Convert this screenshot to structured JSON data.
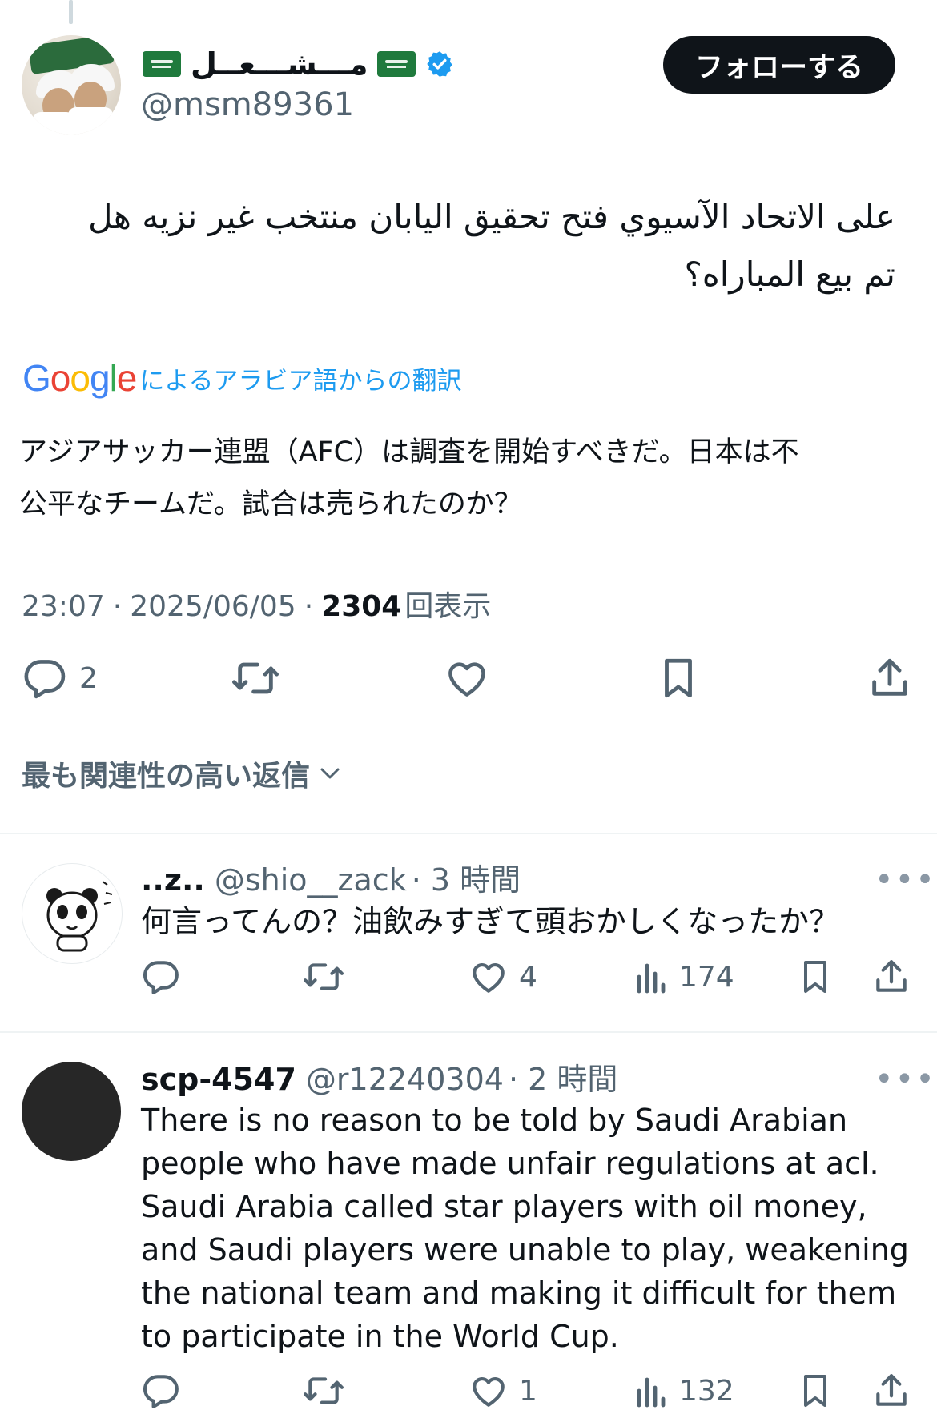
{
  "tweet": {
    "display_name": "مـــشـــعــل",
    "handle": "@msm89361",
    "follow_label": "フォローする",
    "text_original_line1": "على الاتحاد الآسيوي فتح تحقيق اليابان منتخب غير نزيه هل",
    "text_original_line2": "تم بيع المباراه؟",
    "translation_prefix": "Google",
    "translation_label": "によるアラビア語からの翻訳",
    "text_translated_line1": "アジアサッカー連盟（AFC）は調査を開始すべきだ。日本は不",
    "text_translated_line2": "公平なチームだ。試合は売られたのか？",
    "time": "23:07",
    "date": "2025/06/05",
    "views_count": "2304",
    "views_label": "回表示",
    "sep": "·",
    "reply_count": "2"
  },
  "sort": {
    "label": "最も関連性の高い返信"
  },
  "replies": [
    {
      "name": "..z..",
      "handle": "@shio__zack",
      "time": "· 3 時間",
      "text": "何言ってんの？油飲みすぎて頭おかしくなったか？",
      "likes": "4",
      "views": "174"
    },
    {
      "name": "scp-4547",
      "handle": "@r12240304",
      "time": "· 2 時間",
      "text_lines": [
        "There is no reason to be told by Saudi Arabian",
        "people who have made unfair regulations at acl.",
        "Saudi Arabia called star players with oil money,",
        "and Saudi players were unable to play, weakening",
        "the national team and making it difficult for them",
        "to participate in the World Cup."
      ],
      "likes": "1",
      "views": "132"
    }
  ],
  "more_label": "•••",
  "colors": {
    "accent": "#1d9bf0",
    "text": "#0f1419",
    "muted": "#536471",
    "flag_green": "#1f7a3d"
  },
  "icons": [
    "reply-icon",
    "retweet-icon",
    "like-icon",
    "bookmark-icon",
    "share-icon",
    "views-icon",
    "verified-badge-icon",
    "saudi-flag-icon",
    "chevron-down-icon",
    "more-icon"
  ]
}
